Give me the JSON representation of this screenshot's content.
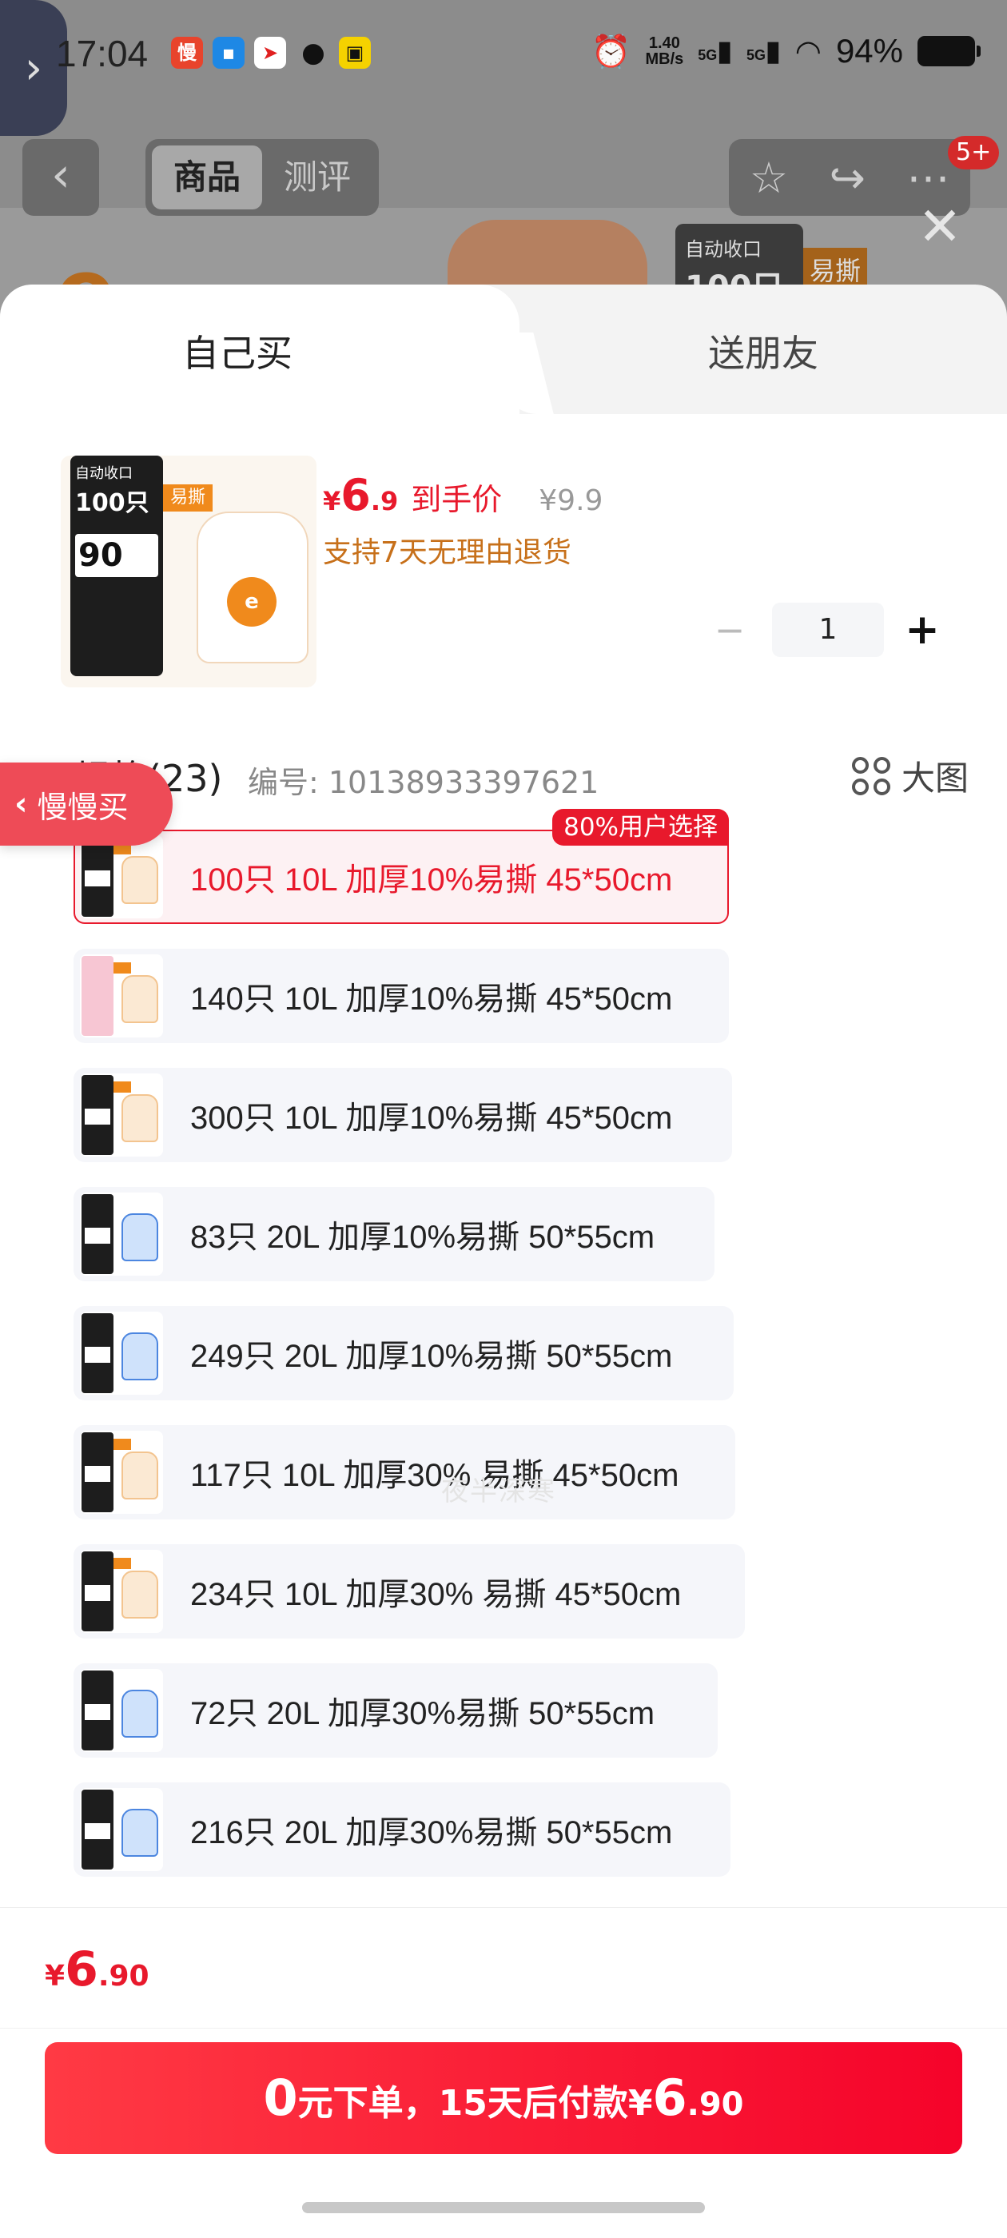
{
  "status_bar": {
    "time": "17:04",
    "apps": [
      "慢",
      "",
      "",
      "",
      ""
    ],
    "net_speed_value": "1.40",
    "net_speed_unit": "MB/s",
    "signal1": "5G",
    "signal2": "5G",
    "battery_pct": "94%"
  },
  "background": {
    "segment": [
      "商品",
      "测评"
    ],
    "actions_badge": "5+",
    "hero_card_line1": "自动收口",
    "hero_card_line2": "100只",
    "hero_card_tag": "易撕"
  },
  "sheet": {
    "tabs": [
      "自己买",
      "送朋友"
    ],
    "product": {
      "thumb_line1": "自动收口",
      "thumb_line2": "100只",
      "thumb_tag": "易撕",
      "thumb_size": "90",
      "price_symbol": "¥",
      "price_int": "6",
      "price_dec": ".9",
      "price_label": "到手价",
      "original_price": "¥9.9",
      "return_note": "支持7天无理由退货",
      "quantity": "1"
    },
    "spec": {
      "title": "规格(23)",
      "code": "编号: 10138933397621",
      "big_image_label": "大图",
      "selected_badge": "80%用户选择",
      "items": [
        {
          "label": "100只 10L 加厚10%易撕 45*50cm",
          "selected": true
        },
        {
          "label": "140只 10L 加厚10%易撕 45*50cm"
        },
        {
          "label": "300只 10L 加厚10%易撕 45*50cm"
        },
        {
          "label": "83只 20L 加厚10%易撕 50*55cm"
        },
        {
          "label": "249只 20L 加厚10%易撕 50*55cm"
        },
        {
          "label": "117只 10L 加厚30% 易撕 45*50cm"
        },
        {
          "label": "234只 10L 加厚30% 易撕 45*50cm"
        },
        {
          "label": "72只 20L 加厚30%易撕 50*55cm"
        },
        {
          "label": "216只 20L 加厚30%易撕 50*55cm"
        }
      ]
    },
    "slow_buy_label": "慢慢买",
    "watermark": "夜半深寒"
  },
  "bottom": {
    "price_symbol": "¥",
    "price_int": "6",
    "price_dec": ".90",
    "buy_btn": {
      "part_big": "0",
      "part_text": "元下单，15天后付款¥",
      "part_int": "6",
      "part_dec": ".90"
    }
  }
}
